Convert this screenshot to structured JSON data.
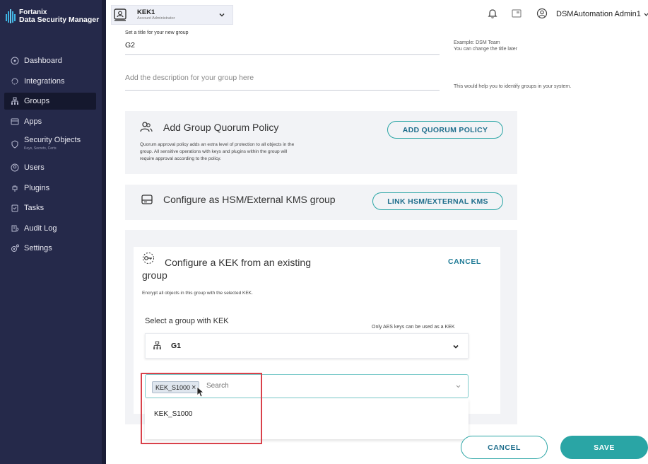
{
  "brand": {
    "name": "Fortanix",
    "product": "Data Security Manager"
  },
  "sidebar": {
    "items": [
      {
        "label": "Dashboard",
        "icon": "dashboard-icon"
      },
      {
        "label": "Integrations",
        "icon": "integrations-icon"
      },
      {
        "label": "Groups",
        "icon": "groups-icon",
        "active": true
      },
      {
        "label": "Apps",
        "icon": "apps-icon"
      },
      {
        "label": "Security Objects",
        "sub": "Keys, Secrets, Certs",
        "icon": "security-objects-icon"
      },
      {
        "label": "Users",
        "icon": "users-icon"
      },
      {
        "label": "Plugins",
        "icon": "plugins-icon"
      },
      {
        "label": "Tasks",
        "icon": "tasks-icon"
      },
      {
        "label": "Audit Log",
        "icon": "audit-log-icon"
      },
      {
        "label": "Settings",
        "icon": "settings-icon"
      }
    ]
  },
  "account": {
    "name": "KEK1",
    "role": "Account Administrator"
  },
  "user": {
    "name": "DSMAutomation Admin1"
  },
  "form": {
    "title_label": "Set a title for your new group",
    "title_value": "G2",
    "title_hint_1": "Example: DSM Team",
    "title_hint_2": "You can change the title later",
    "description_placeholder": "Add the description for your group here",
    "description_hint": "This would help you to identify groups in your system."
  },
  "quorum": {
    "title": "Add Group Quorum Policy",
    "desc_1": "Quorum approval policy adds an extra level of protection to all objects in the",
    "desc_2": "group. All sensitive operations with keys and plugins within the group will",
    "desc_3": "require approval according to the policy.",
    "button": "ADD QUORUM POLICY"
  },
  "hsm": {
    "title": "Configure as HSM/External KMS group",
    "button": "LINK HSM/EXTERNAL KMS"
  },
  "kek": {
    "title_1": "Configure a KEK from an existing",
    "title_2": "group",
    "cancel": "CANCEL",
    "desc": "Encrypt all objects in this group with the selected KEK.",
    "select_label": "Select a group with KEK",
    "select_hint": "Only AES keys can be used as a KEK",
    "selected_group": "G1",
    "chip": "KEK_S1000",
    "search_placeholder": "Search",
    "dropdown_option": "KEK_S1000"
  },
  "footer": {
    "cancel": "CANCEL",
    "save": "SAVE"
  },
  "colors": {
    "sidebar": "#25294a",
    "accent": "#2aa5a5",
    "highlight": "#d9414a"
  }
}
